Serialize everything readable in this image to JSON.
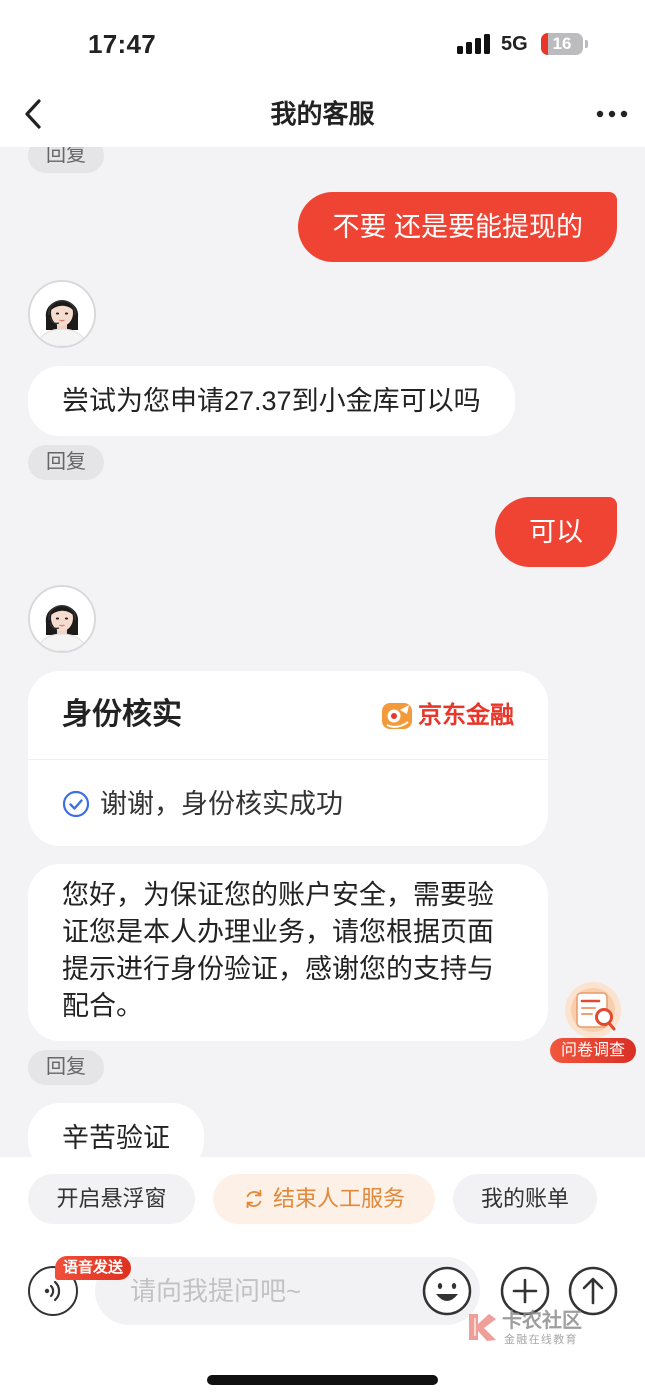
{
  "status_bar": {
    "time": "17:47",
    "network": "5G",
    "battery_level": "16",
    "signal_icon": "signal-bars-icon",
    "battery_icon": "battery-icon"
  },
  "header": {
    "title": "我的客服",
    "back_icon": "chevron-left-icon",
    "more_icon": "more-dots-icon"
  },
  "chat": {
    "reply_label": "回复",
    "agent_avatar_icon": "agent-avatar-icon",
    "messages": [
      {
        "outgoing": "不要 还是要能提现的"
      },
      {
        "incoming": "尝试为您申请27.37到小金库可以吗"
      },
      {
        "outgoing": "可以"
      },
      {
        "card": {
          "title": "身份核实",
          "brand": "京东金融",
          "brand_icon": "jd-finance-logo-icon",
          "status_text": "谢谢，身份核实成功",
          "status_icon": "check-circle-icon"
        }
      },
      {
        "incoming": "您好，为保证您的账户安全，需要验证您是本人办理业务，请您根据页面提示进行身份验证，感谢您的支持与配合。"
      },
      {
        "incoming": "辛苦验证"
      }
    ]
  },
  "survey_badge": {
    "label": "问卷调查",
    "icon": "survey-document-icon"
  },
  "quick_actions": [
    {
      "label": "开启悬浮窗"
    },
    {
      "label": "结束人工服务",
      "icon": "refresh-icon",
      "highlighted": true
    },
    {
      "label": "我的账单"
    }
  ],
  "composer": {
    "voice_badge": "语音发送",
    "placeholder": "请向我提问吧~",
    "voice_icon": "voice-wave-icon",
    "emoji_icon": "smile-emoji-icon",
    "plus_icon": "plus-circle-icon",
    "send_icon": "arrow-up-circle-icon"
  },
  "watermark": {
    "name": "卡农社区",
    "tagline": "金融在线教育"
  },
  "colors": {
    "accent_red": "#ef4433",
    "chat_background": "#f3f3f5",
    "brand_red": "#e8372a",
    "battery_red": "#e8372a",
    "end_service_text": "#e2883a"
  }
}
